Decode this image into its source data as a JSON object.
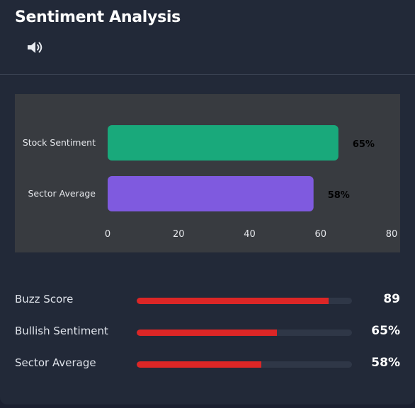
{
  "header": {
    "title": "Sentiment Analysis",
    "speaker_icon": "speaker-icon"
  },
  "chart_data": {
    "type": "bar",
    "orientation": "horizontal",
    "categories": [
      "Stock Sentiment",
      "Sector Average"
    ],
    "values": [
      65,
      58
    ],
    "data_labels": [
      "65%",
      "58%"
    ],
    "colors": [
      "#19a97b",
      "#7f5adf"
    ],
    "xlim": [
      0,
      80
    ],
    "x_ticks": [
      "0",
      "20",
      "40",
      "60",
      "80"
    ],
    "title": "",
    "xlabel": "",
    "ylabel": "",
    "grid": false
  },
  "metrics": [
    {
      "label": "Buzz Score",
      "value": 89,
      "display": "89",
      "fraction": 0.89
    },
    {
      "label": "Bullish Sentiment",
      "value": 65,
      "display": "65%",
      "fraction": 0.65
    },
    {
      "label": "Sector Average",
      "value": 58,
      "display": "58%",
      "fraction": 0.58
    }
  ],
  "colors": {
    "metric_fill": "#dc2626",
    "track": "#2f3747",
    "background": "#222938"
  }
}
